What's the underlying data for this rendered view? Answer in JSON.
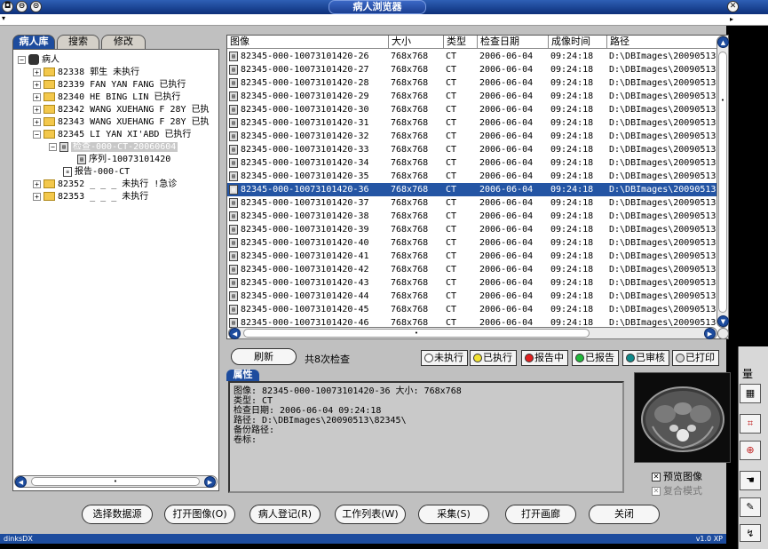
{
  "window": {
    "title": "病人浏览器"
  },
  "tabs": [
    "病人库",
    "搜索",
    "修改"
  ],
  "tree": {
    "root": "病人",
    "patients": [
      {
        "id": "82338",
        "name": "郭生 未执行",
        "expanded": false
      },
      {
        "id": "82339",
        "name": "FAN YAN FANG 已执行",
        "expanded": false
      },
      {
        "id": "82340",
        "name": "HE BING LIN 已执行",
        "expanded": false
      },
      {
        "id": "82342",
        "name": "WANG XUEHANG F 28Y 已执",
        "expanded": false
      },
      {
        "id": "82343",
        "name": "WANG XUEHANG F 28Y 已执",
        "expanded": false
      },
      {
        "id": "82345",
        "name": "LI YAN XI'ABD 已执行",
        "expanded": true
      },
      {
        "id": "82352",
        "name": "_ _ _ 未执行 !急诊",
        "expanded": false
      },
      {
        "id": "82353",
        "name": "_ _ _ 未执行",
        "expanded": false
      }
    ],
    "exam": "检查-000-CT-20060604",
    "series": "序列-10073101420",
    "report": "报告-000-CT"
  },
  "grid": {
    "headers": [
      "图像",
      "大小",
      "类型",
      "检查日期",
      "成像时间",
      "路径"
    ],
    "selected_index": 10,
    "rows": [
      [
        "82345-000-10073101420-26",
        "768x768",
        "CT",
        "2006-06-04",
        "09:24:18",
        "D:\\DBImages\\20090513"
      ],
      [
        "82345-000-10073101420-27",
        "768x768",
        "CT",
        "2006-06-04",
        "09:24:18",
        "D:\\DBImages\\20090513"
      ],
      [
        "82345-000-10073101420-28",
        "768x768",
        "CT",
        "2006-06-04",
        "09:24:18",
        "D:\\DBImages\\20090513"
      ],
      [
        "82345-000-10073101420-29",
        "768x768",
        "CT",
        "2006-06-04",
        "09:24:18",
        "D:\\DBImages\\20090513"
      ],
      [
        "82345-000-10073101420-30",
        "768x768",
        "CT",
        "2006-06-04",
        "09:24:18",
        "D:\\DBImages\\20090513"
      ],
      [
        "82345-000-10073101420-31",
        "768x768",
        "CT",
        "2006-06-04",
        "09:24:18",
        "D:\\DBImages\\20090513"
      ],
      [
        "82345-000-10073101420-32",
        "768x768",
        "CT",
        "2006-06-04",
        "09:24:18",
        "D:\\DBImages\\20090513"
      ],
      [
        "82345-000-10073101420-33",
        "768x768",
        "CT",
        "2006-06-04",
        "09:24:18",
        "D:\\DBImages\\20090513"
      ],
      [
        "82345-000-10073101420-34",
        "768x768",
        "CT",
        "2006-06-04",
        "09:24:18",
        "D:\\DBImages\\20090513"
      ],
      [
        "82345-000-10073101420-35",
        "768x768",
        "CT",
        "2006-06-04",
        "09:24:18",
        "D:\\DBImages\\20090513"
      ],
      [
        "82345-000-10073101420-36",
        "768x768",
        "CT",
        "2006-06-04",
        "09:24:18",
        "D:\\DBImages\\20090513"
      ],
      [
        "82345-000-10073101420-37",
        "768x768",
        "CT",
        "2006-06-04",
        "09:24:18",
        "D:\\DBImages\\20090513"
      ],
      [
        "82345-000-10073101420-38",
        "768x768",
        "CT",
        "2006-06-04",
        "09:24:18",
        "D:\\DBImages\\20090513"
      ],
      [
        "82345-000-10073101420-39",
        "768x768",
        "CT",
        "2006-06-04",
        "09:24:18",
        "D:\\DBImages\\20090513"
      ],
      [
        "82345-000-10073101420-40",
        "768x768",
        "CT",
        "2006-06-04",
        "09:24:18",
        "D:\\DBImages\\20090513"
      ],
      [
        "82345-000-10073101420-41",
        "768x768",
        "CT",
        "2006-06-04",
        "09:24:18",
        "D:\\DBImages\\20090513"
      ],
      [
        "82345-000-10073101420-42",
        "768x768",
        "CT",
        "2006-06-04",
        "09:24:18",
        "D:\\DBImages\\20090513"
      ],
      [
        "82345-000-10073101420-43",
        "768x768",
        "CT",
        "2006-06-04",
        "09:24:18",
        "D:\\DBImages\\20090513"
      ],
      [
        "82345-000-10073101420-44",
        "768x768",
        "CT",
        "2006-06-04",
        "09:24:18",
        "D:\\DBImages\\20090513"
      ],
      [
        "82345-000-10073101420-45",
        "768x768",
        "CT",
        "2006-06-04",
        "09:24:18",
        "D:\\DBImages\\20090513"
      ],
      [
        "82345-000-10073101420-46",
        "768x768",
        "CT",
        "2006-06-04",
        "09:24:18",
        "D:\\DBImages\\20090513"
      ]
    ]
  },
  "toolbar": {
    "refresh": "刷新",
    "count_text": "共8次检查",
    "status_buttons": [
      {
        "label": "未执行",
        "color": "#ffffff",
        "icon": "smiley-icon"
      },
      {
        "label": "已执行",
        "color": "#f2e233",
        "icon": "smiley-icon"
      },
      {
        "label": "报告中",
        "color": "#e02020",
        "icon": "dot-icon"
      },
      {
        "label": "已报告",
        "color": "#1fb83a",
        "icon": "smiley-icon"
      },
      {
        "label": "已审核",
        "color": "#0f8a8a",
        "icon": "smiley-icon"
      },
      {
        "label": "已打印",
        "color": "#d8d8d8",
        "icon": "smiley-icon"
      }
    ]
  },
  "properties": {
    "tab": "属性",
    "lines": [
      "图像: 82345-000-10073101420-36 大小: 768x768",
      "类型: CT",
      "检查日期: 2006-06-04 09:24:18",
      "路径: D:\\DBImages\\20090513\\82345\\",
      "备份路径:",
      "卷标:"
    ]
  },
  "preview": {
    "show_label": "预览图像",
    "show_checked": true,
    "overlay_label": "复合模式",
    "overlay_checked": true,
    "overlay_enabled": false
  },
  "actions": [
    "选择数据源",
    "打开图像(O)",
    "病人登记(R)",
    "工作列表(W)",
    "采集(S)",
    "打开画廊",
    "关闭"
  ],
  "side_panel": {
    "label": "量"
  },
  "status": {
    "left": "dinksDX",
    "right": "v1.0 XP"
  }
}
